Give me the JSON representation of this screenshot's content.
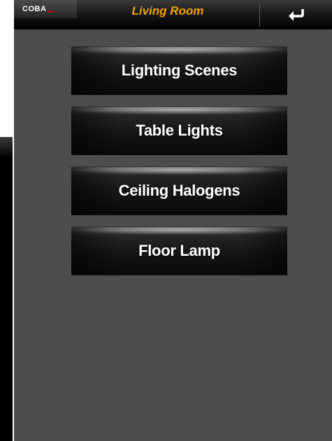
{
  "header": {
    "logo_text": "COBA",
    "title": "Living Room",
    "back_icon": "return-arrow-icon"
  },
  "colors": {
    "title": "#f0a000",
    "background": "#4d4d4d",
    "logo_accent": "#b5121b"
  },
  "menu": {
    "items": [
      {
        "label": "Lighting Scenes"
      },
      {
        "label": "Table Lights"
      },
      {
        "label": "Ceiling Halogens"
      },
      {
        "label": "Floor Lamp"
      }
    ]
  }
}
